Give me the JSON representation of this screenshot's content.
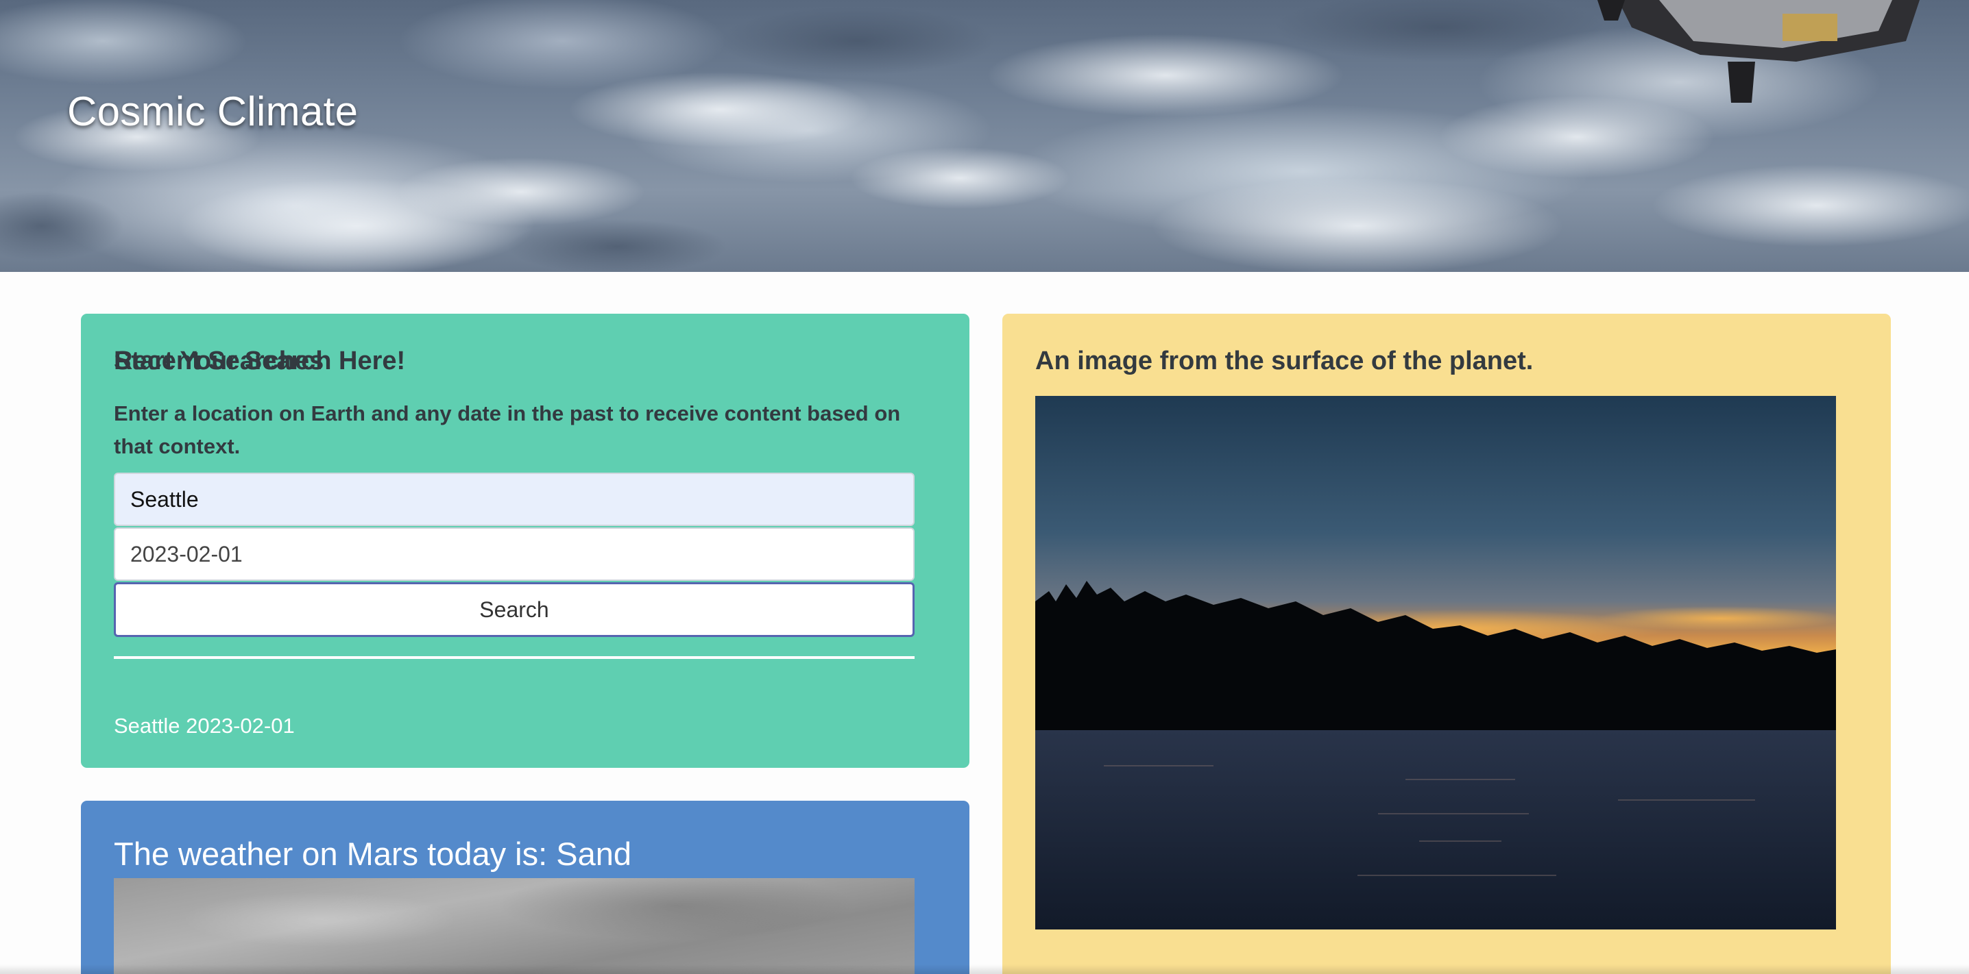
{
  "header": {
    "title": "Cosmic Climate"
  },
  "search_card": {
    "heading": "Start Your Search Here!",
    "description": "Enter a location on Earth and any date in the past to receive content based on that context.",
    "location_value": "Seattle",
    "date_value": "2023-02-01",
    "search_label": "Search",
    "recent_heading": "Recent Searches",
    "recent_items": [
      "Seattle 2023-02-01"
    ]
  },
  "mars_card": {
    "title": "The weather on Mars today is: Sand"
  },
  "surface_card": {
    "heading": "An image from the surface of the planet."
  },
  "colors": {
    "search_card": "#5fcfb1",
    "mars_card": "#548acb",
    "surface_card": "#f9df91",
    "search_button_border": "#5664b0"
  }
}
